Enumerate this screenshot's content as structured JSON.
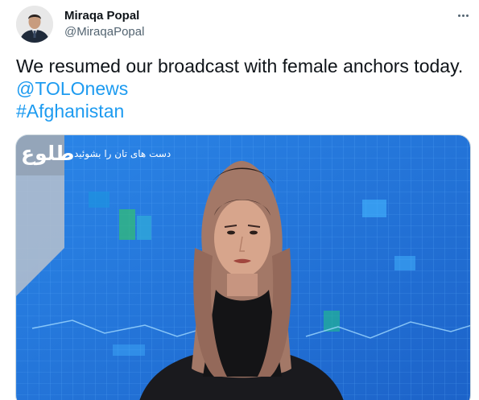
{
  "author": {
    "name": "Miraqa Popal",
    "handle": "@MiraqaPopal"
  },
  "tweet": {
    "text": "We resumed our broadcast with female anchors today.",
    "mention": "@TOLOnews",
    "hashtag": "#Afghanistan"
  },
  "media": {
    "logo_text": "طلوع",
    "caption": "دست های تان را بشوئید"
  },
  "icons": {
    "more": "more-horizontal-icon"
  },
  "colors": {
    "link": "#1d9bf0",
    "text": "#0f1419",
    "secondary": "#536471",
    "studio_blue": "#1c6fd6"
  }
}
